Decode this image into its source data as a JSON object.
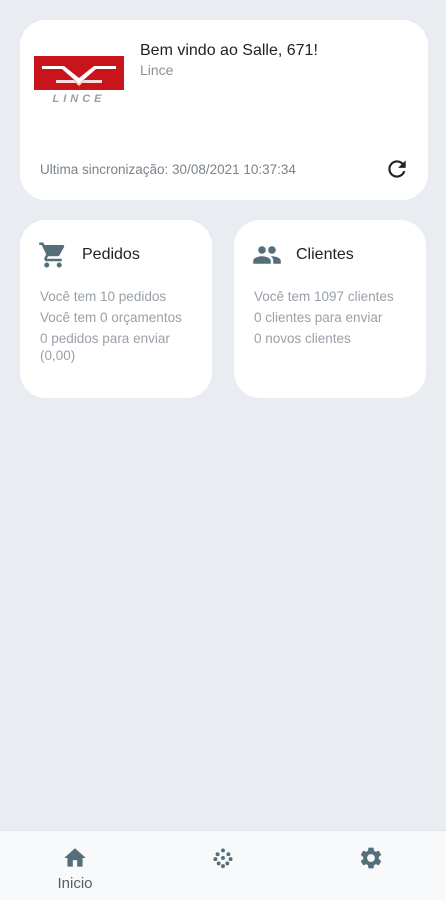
{
  "welcome": {
    "title": "Bem vindo ao Salle, 671!",
    "company": "Lince",
    "logo_text": "LINCE",
    "sync_text": "Ultima sincronização: 30/08/2021 10:37:34"
  },
  "orders": {
    "title": "Pedidos",
    "lines": [
      "Você tem 10 pedidos",
      "Você tem 0 orçamentos",
      "0 pedidos para enviar (0,00)"
    ]
  },
  "clients": {
    "title": "Clientes",
    "lines": [
      "Você tem 1097 clientes",
      "0 clientes para enviar",
      "0 novos clientes"
    ]
  },
  "nav": {
    "home_label": "Inicio",
    "items": [
      {
        "icon": "home-icon",
        "label": "Inicio"
      },
      {
        "icon": "dots-grid-icon",
        "label": ""
      },
      {
        "icon": "gear-icon",
        "label": ""
      }
    ]
  },
  "colors": {
    "background": "#e9edf1",
    "card": "#ffffff",
    "logo_red": "#c8141b",
    "icon": "#546e7a",
    "muted_text": "#9aa1a8"
  }
}
